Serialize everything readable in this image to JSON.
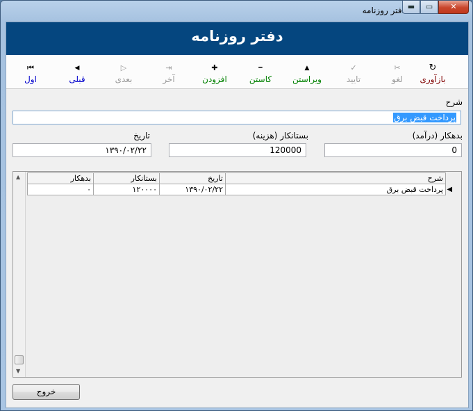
{
  "window": {
    "title": "دفتر روزنامه",
    "min_label": "▬",
    "max_label": "▭",
    "close_label": "✕"
  },
  "banner": {
    "title": "دفتر روزنامه"
  },
  "toolbar": {
    "refresh": {
      "label": "بازآوری",
      "icon": "↻",
      "color": "#800000"
    },
    "cancel": {
      "label": "لغو",
      "icon": "✂",
      "color": "#9a9a9a"
    },
    "confirm": {
      "label": "تایید",
      "icon": "✓",
      "color": "#9a9a9a"
    },
    "edit": {
      "label": "ویراستن",
      "icon": "▲",
      "color": "#008000"
    },
    "delete": {
      "label": "کاستن",
      "icon": "━",
      "color": "#008000"
    },
    "add": {
      "label": "افزودن",
      "icon": "✚",
      "color": "#008000"
    },
    "last": {
      "label": "آخر",
      "icon": "⇥",
      "color": "#9a9a9a"
    },
    "next": {
      "label": "بعدی",
      "icon": "▷",
      "color": "#9a9a9a"
    },
    "prev": {
      "label": "قبلی",
      "icon": "◀",
      "color": "#0000cc"
    },
    "first": {
      "label": "اول",
      "icon": "⏮",
      "color": "#0000cc"
    }
  },
  "form": {
    "description_label": "شرح",
    "description_value": "پرداخت قبض برق",
    "debit_label": "بدهکار (درآمد)",
    "debit_value": "0",
    "credit_label": "بستانکار (هزینه)",
    "credit_value": "120000",
    "date_label": "تاریخ",
    "date_value": "۱۳۹۰/۰۲/۲۲"
  },
  "grid": {
    "columns": {
      "debit": "بدهکار",
      "credit": "بستانکار",
      "date": "تاریخ",
      "description": "شرح"
    },
    "rows": [
      {
        "debit": "۰",
        "credit": "۱۲۰۰۰۰",
        "date": "۱۳۹۰/۰۲/۲۲",
        "description": "پرداخت قبض برق"
      }
    ]
  },
  "footer": {
    "exit_label": "خروج"
  }
}
